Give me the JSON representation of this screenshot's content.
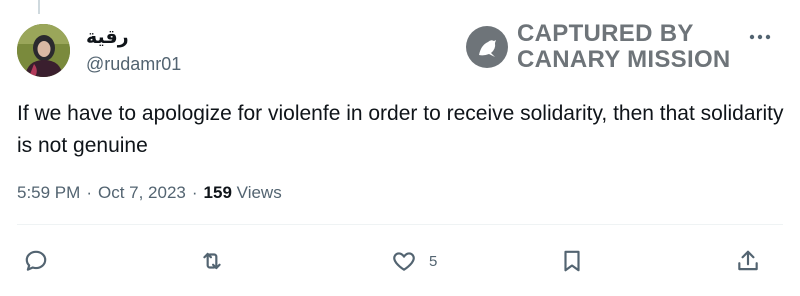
{
  "user": {
    "display_name": "رقية",
    "handle": "@rudamr01"
  },
  "watermark": {
    "line1": "CAPTURED BY",
    "line2": "CANARY MISSION"
  },
  "tweet": {
    "text": "If we have to apologize for violenfe in order to receive solidarity, then that solidarity is not genuine",
    "time": "5:59 PM",
    "separator": "·",
    "date": "Oct 7, 2023",
    "views_count": "159",
    "views_label": "Views"
  },
  "actions": {
    "like_count": "5"
  },
  "icons": {
    "more": "more-icon",
    "reply": "reply-icon",
    "retweet": "retweet-icon",
    "like": "heart-icon",
    "bookmark": "bookmark-icon",
    "share": "share-icon"
  },
  "colors": {
    "text": "#0f1419",
    "secondary": "#536471",
    "watermark": "#6e7479"
  }
}
